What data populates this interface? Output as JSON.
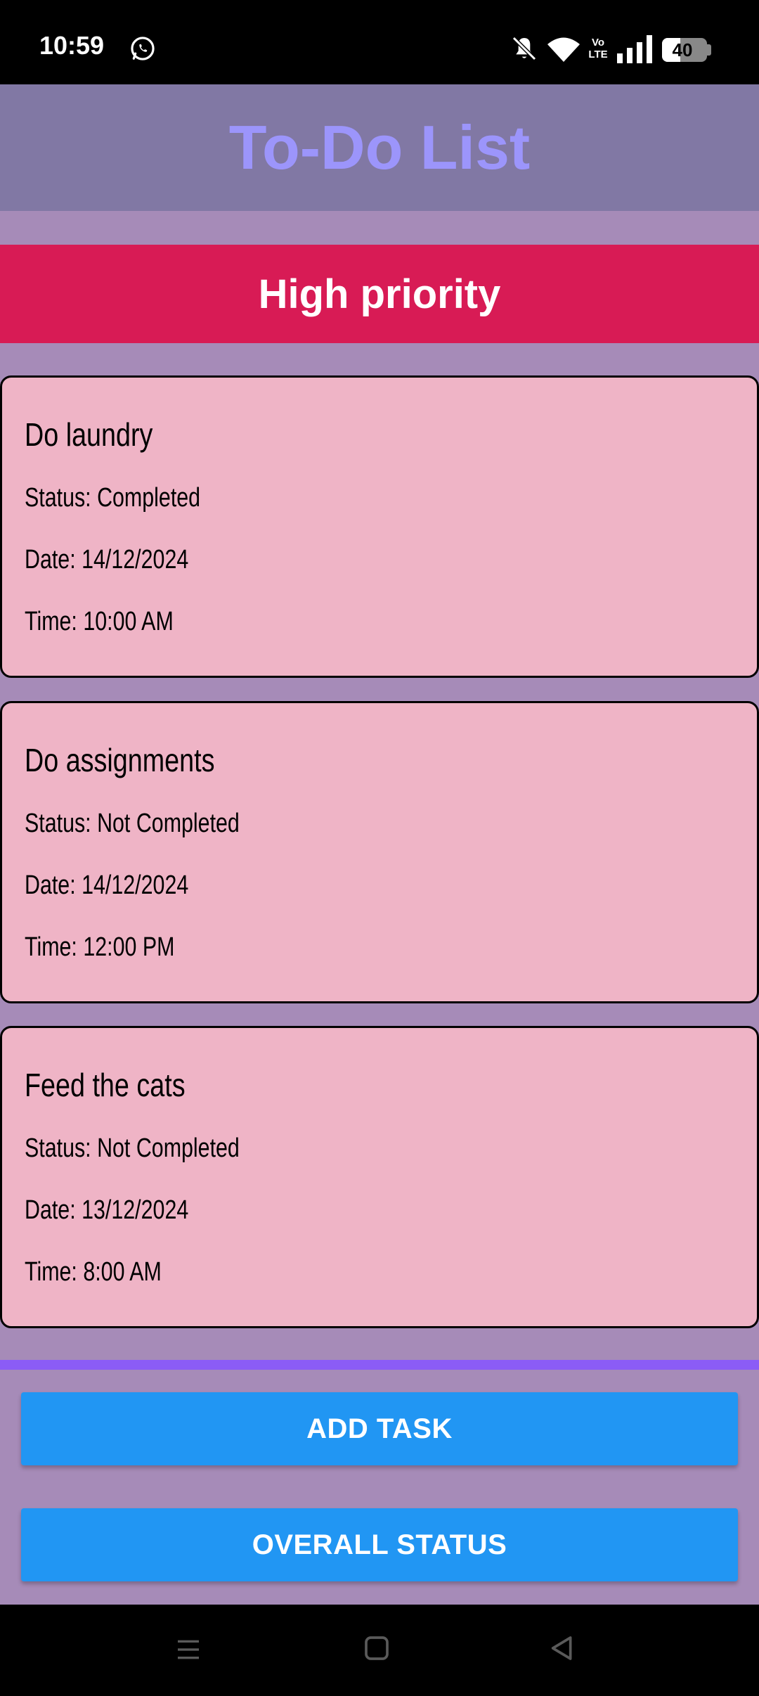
{
  "status_bar": {
    "time": "10:59",
    "volte_label": "Vo LTE",
    "battery_level": "40",
    "icons": [
      "whatsapp-icon",
      "bell-muted-icon",
      "wifi-icon",
      "volte-icon",
      "signal-icon",
      "battery-icon"
    ]
  },
  "app": {
    "title": "To-Do List",
    "title_color": "#9c95fb",
    "header_color": "#8178a4"
  },
  "section": {
    "label": "High priority",
    "color": "#d81b55"
  },
  "tasks": [
    {
      "name": "Do laundry",
      "status": "Status: Completed",
      "date": "Date: 14/12/2024",
      "time": "Time: 10:00 AM"
    },
    {
      "name": "Do assignments",
      "status": "Status: Not Completed",
      "date": "Date: 14/12/2024",
      "time": "Time: 12:00 PM"
    },
    {
      "name": "Feed the cats",
      "status": "Status: Not Completed",
      "date": "Date: 13/12/2024",
      "time": "Time: 8:00 AM"
    }
  ],
  "buttons": {
    "add_task": "ADD TASK",
    "overall_status": "OVERALL STATUS",
    "color": "#2196f3"
  },
  "nav_bar": {
    "icons": [
      "menu-icon",
      "home-icon",
      "back-icon"
    ]
  }
}
